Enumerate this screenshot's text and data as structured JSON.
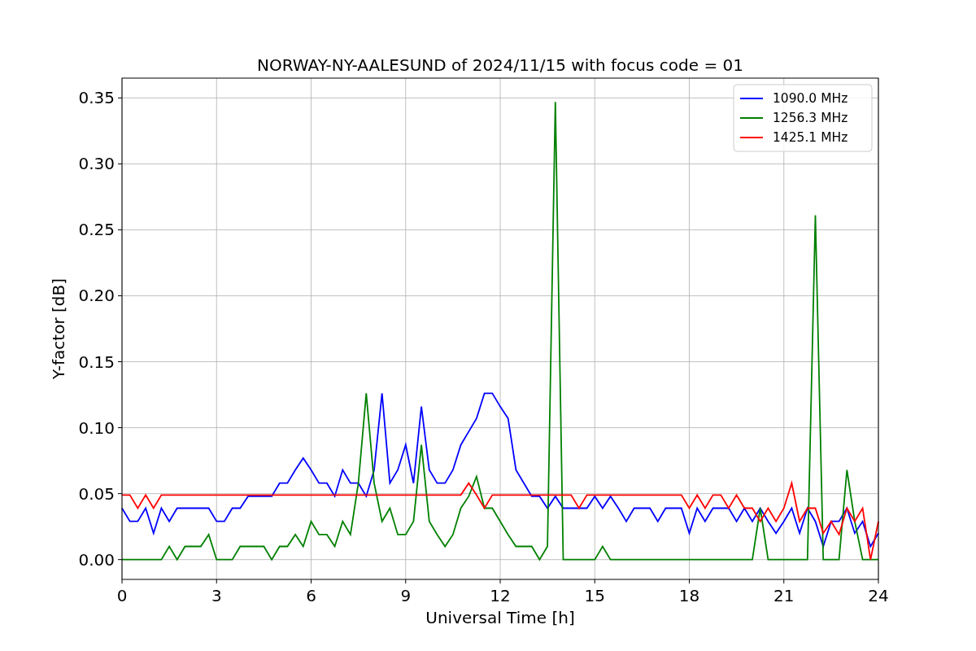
{
  "chart_data": {
    "type": "line",
    "title": "NORWAY-NY-AALESUND of 2024/11/15 with focus code = 01",
    "xlabel": "Universal Time [h]",
    "ylabel": "Y-factor [dB]",
    "x": [
      0,
      0.25,
      0.5,
      0.75,
      1,
      1.25,
      1.5,
      1.75,
      2,
      2.25,
      2.5,
      2.75,
      3,
      3.25,
      3.5,
      3.75,
      4,
      4.25,
      4.5,
      4.75,
      5,
      5.25,
      5.5,
      5.75,
      6,
      6.25,
      6.5,
      6.75,
      7,
      7.25,
      7.5,
      7.75,
      8,
      8.25,
      8.5,
      8.75,
      9,
      9.25,
      9.5,
      9.75,
      10,
      10.25,
      10.5,
      10.75,
      11,
      11.25,
      11.5,
      11.75,
      12,
      12.25,
      12.5,
      12.75,
      13,
      13.25,
      13.5,
      13.75,
      14,
      14.25,
      14.5,
      14.75,
      15,
      15.25,
      15.5,
      15.75,
      16,
      16.25,
      16.5,
      16.75,
      17,
      17.25,
      17.5,
      17.75,
      18,
      18.25,
      18.5,
      18.75,
      19,
      19.25,
      19.5,
      19.75,
      20,
      20.25,
      20.5,
      20.75,
      21,
      21.25,
      21.5,
      21.75,
      22,
      22.25,
      22.5,
      22.75,
      23,
      23.25,
      23.5,
      23.75,
      24
    ],
    "series": [
      {
        "name": "1090.0 MHz",
        "color": "#0000ff",
        "values": [
          0.039,
          0.029,
          0.029,
          0.039,
          0.02,
          0.039,
          0.029,
          0.039,
          0.039,
          0.039,
          0.039,
          0.039,
          0.029,
          0.029,
          0.039,
          0.039,
          0.048,
          0.048,
          0.048,
          0.048,
          0.058,
          0.058,
          0.068,
          0.077,
          0.068,
          0.058,
          0.058,
          0.048,
          0.068,
          0.058,
          0.058,
          0.048,
          0.068,
          0.126,
          0.058,
          0.068,
          0.087,
          0.058,
          0.116,
          0.068,
          0.058,
          0.058,
          0.068,
          0.087,
          0.097,
          0.107,
          0.126,
          0.126,
          0.116,
          0.107,
          0.068,
          0.058,
          0.048,
          0.048,
          0.039,
          0.048,
          0.039,
          0.039,
          0.039,
          0.039,
          0.048,
          0.039,
          0.048,
          0.039,
          0.029,
          0.039,
          0.039,
          0.039,
          0.029,
          0.039,
          0.039,
          0.039,
          0.02,
          0.039,
          0.029,
          0.039,
          0.039,
          0.039,
          0.029,
          0.039,
          0.029,
          0.039,
          0.029,
          0.02,
          0.029,
          0.039,
          0.02,
          0.039,
          0.029,
          0.01,
          0.029,
          0.029,
          0.039,
          0.02,
          0.029,
          0.01,
          0.02
        ]
      },
      {
        "name": "1256.3 MHz",
        "color": "#008000",
        "values": [
          0,
          0,
          0,
          0,
          0,
          0,
          0.01,
          0,
          0.01,
          0.01,
          0.01,
          0.019,
          0,
          0,
          0,
          0.01,
          0.01,
          0.01,
          0.01,
          0,
          0.01,
          0.01,
          0.019,
          0.01,
          0.029,
          0.019,
          0.019,
          0.01,
          0.029,
          0.019,
          0.058,
          0.126,
          0.058,
          0.029,
          0.039,
          0.019,
          0.019,
          0.029,
          0.087,
          0.029,
          0.019,
          0.01,
          0.019,
          0.039,
          0.048,
          0.063,
          0.039,
          0.039,
          0.029,
          0.019,
          0.01,
          0.01,
          0.01,
          0,
          0.01,
          0.347,
          0,
          0,
          0,
          0,
          0,
          0.01,
          0,
          0,
          0,
          0,
          0,
          0,
          0,
          0,
          0,
          0,
          0,
          0,
          0,
          0,
          0,
          0,
          0,
          0,
          0,
          0.039,
          0,
          0,
          0,
          0,
          0,
          0,
          0.261,
          0,
          0,
          0,
          0.068,
          0.029,
          0,
          0,
          0
        ]
      },
      {
        "name": "1425.1 MHz",
        "color": "#ff0000",
        "values": [
          0.049,
          0.049,
          0.039,
          0.049,
          0.039,
          0.049,
          0.049,
          0.049,
          0.049,
          0.049,
          0.049,
          0.049,
          0.049,
          0.049,
          0.049,
          0.049,
          0.049,
          0.049,
          0.049,
          0.049,
          0.049,
          0.049,
          0.049,
          0.049,
          0.049,
          0.049,
          0.049,
          0.049,
          0.049,
          0.049,
          0.049,
          0.049,
          0.049,
          0.049,
          0.049,
          0.049,
          0.049,
          0.049,
          0.049,
          0.049,
          0.049,
          0.049,
          0.049,
          0.049,
          0.058,
          0.049,
          0.039,
          0.049,
          0.049,
          0.049,
          0.049,
          0.049,
          0.049,
          0.049,
          0.049,
          0.049,
          0.049,
          0.049,
          0.039,
          0.049,
          0.049,
          0.049,
          0.049,
          0.049,
          0.049,
          0.049,
          0.049,
          0.049,
          0.049,
          0.049,
          0.049,
          0.049,
          0.039,
          0.049,
          0.039,
          0.049,
          0.049,
          0.039,
          0.049,
          0.039,
          0.039,
          0.029,
          0.039,
          0.029,
          0.039,
          0.058,
          0.029,
          0.039,
          0.039,
          0.02,
          0.029,
          0.019,
          0.039,
          0.029,
          0.039,
          0,
          0.029
        ]
      }
    ],
    "grid": true,
    "legend": true,
    "xlim": [
      0,
      24
    ],
    "ylim": [
      -0.015,
      0.365
    ],
    "xticks": [
      0,
      3,
      6,
      9,
      12,
      15,
      18,
      21,
      24
    ],
    "yticks": [
      {
        "value": 0,
        "label": "0.00"
      },
      {
        "value": 0.05,
        "label": "0.05"
      },
      {
        "value": 0.1,
        "label": "0.10"
      },
      {
        "value": 0.15,
        "label": "0.15"
      },
      {
        "value": 0.2,
        "label": "0.20"
      },
      {
        "value": 0.25,
        "label": "0.25"
      },
      {
        "value": 0.3,
        "label": "0.30"
      },
      {
        "value": 0.35,
        "label": "0.35"
      }
    ]
  }
}
